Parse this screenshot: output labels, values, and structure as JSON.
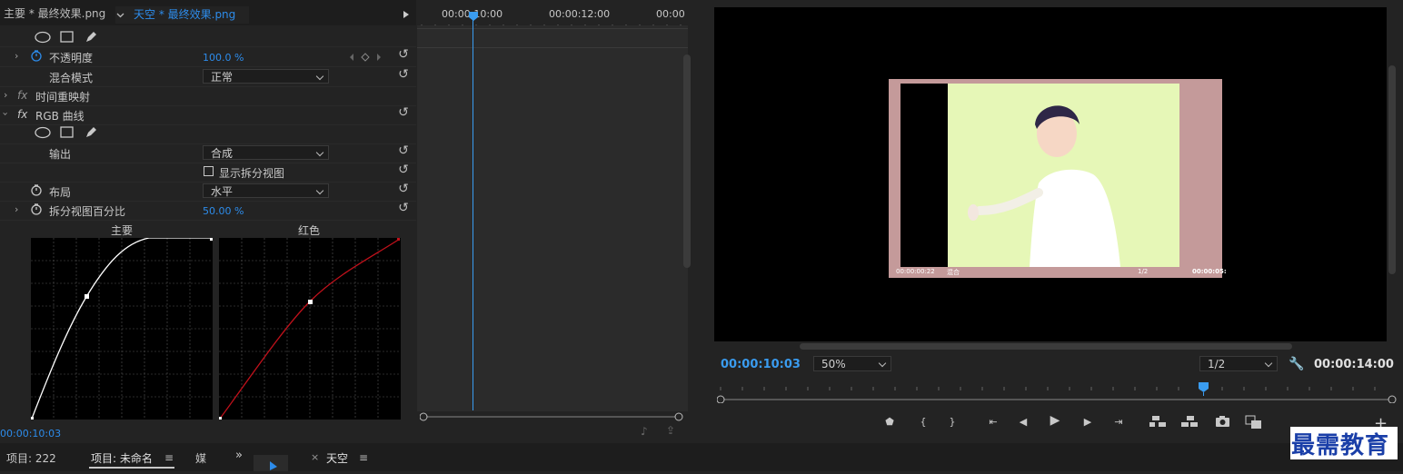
{
  "effect_controls": {
    "tabs": [
      {
        "label": "主要 * 最终效果.png"
      },
      {
        "label": "天空 * 最终效果.png"
      }
    ],
    "opacity": {
      "label": "不透明度",
      "value": "100.0 %"
    },
    "blend_mode": {
      "label": "混合模式",
      "value": "正常"
    },
    "time_remap": {
      "label": "时间重映射"
    },
    "rgb_curves": {
      "label": "RGB 曲线"
    },
    "output": {
      "label": "输出",
      "value": "合成"
    },
    "split_view": {
      "label": "显示拆分视图"
    },
    "layout": {
      "label": "布局",
      "value": "水平"
    },
    "split_percent": {
      "label": "拆分视图百分比",
      "value": "50.00 %"
    },
    "curves": {
      "master_label": "主要",
      "red_label": "红色"
    },
    "timecode": "00:00:10:03"
  },
  "timeline": {
    "ruler_labels": [
      "00:00:10:00",
      "00:00:12:00",
      "00:00"
    ]
  },
  "program_monitor": {
    "timecode_current": "00:00:10:03",
    "zoom": "50%",
    "resolution": "1/2",
    "timecode_duration": "00:00:14:00",
    "inset": {
      "timecode": "00:00:00:22",
      "mode": "混合",
      "res": "1/2",
      "duration": "00:00:05:"
    }
  },
  "bottom_bar": {
    "project_count": "项目: 222",
    "project_unnamed": "项目: 未命名",
    "media": "媒",
    "sequence_tab": "天空"
  },
  "watermark": "最需教育",
  "colors": {
    "accent": "#2d8ceb",
    "playhead": "#3a9cf0",
    "curve_red": "#c0111b"
  }
}
